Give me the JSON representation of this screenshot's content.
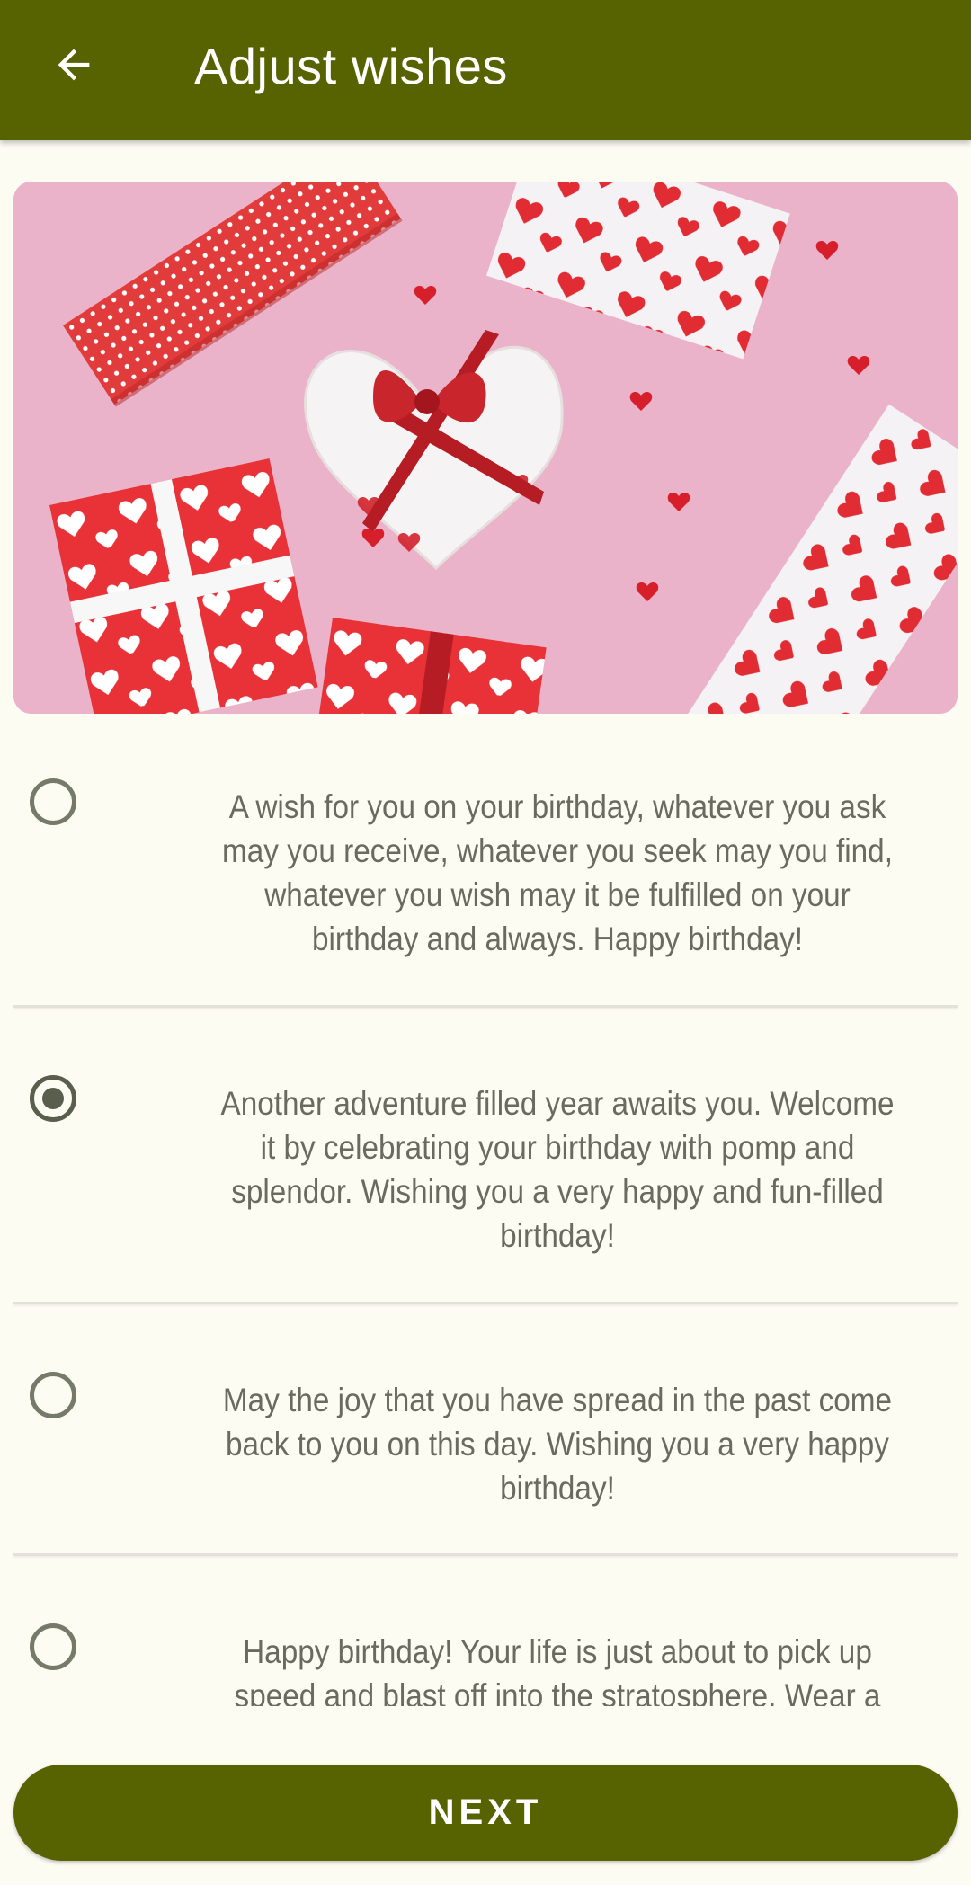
{
  "app_bar": {
    "title": "Adjust wishes",
    "back_icon": "arrow-left-icon",
    "color": "#566300"
  },
  "hero_image": {
    "description_icon": "gift-boxes-image"
  },
  "wishes": [
    {
      "text": "A wish for you on your birthday, whatever you ask may you receive, whatever you seek may you find, whatever you wish may it be fulfilled on your birthday and always. Happy birthday!",
      "selected": false
    },
    {
      "text": "Another adventure filled year awaits you. Welcome it by celebrating your birthday with pomp and splendor. Wishing you a very happy and fun-filled birthday!",
      "selected": true
    },
    {
      "text": "May the joy that you have spread in the past come back to you on this day. Wishing you a very happy birthday!",
      "selected": false
    },
    {
      "text": "Happy birthday! Your life is just about to pick up speed and blast off into the stratosphere. Wear a",
      "selected": false
    }
  ],
  "next_button": {
    "label": "NEXT",
    "color": "#566300"
  }
}
